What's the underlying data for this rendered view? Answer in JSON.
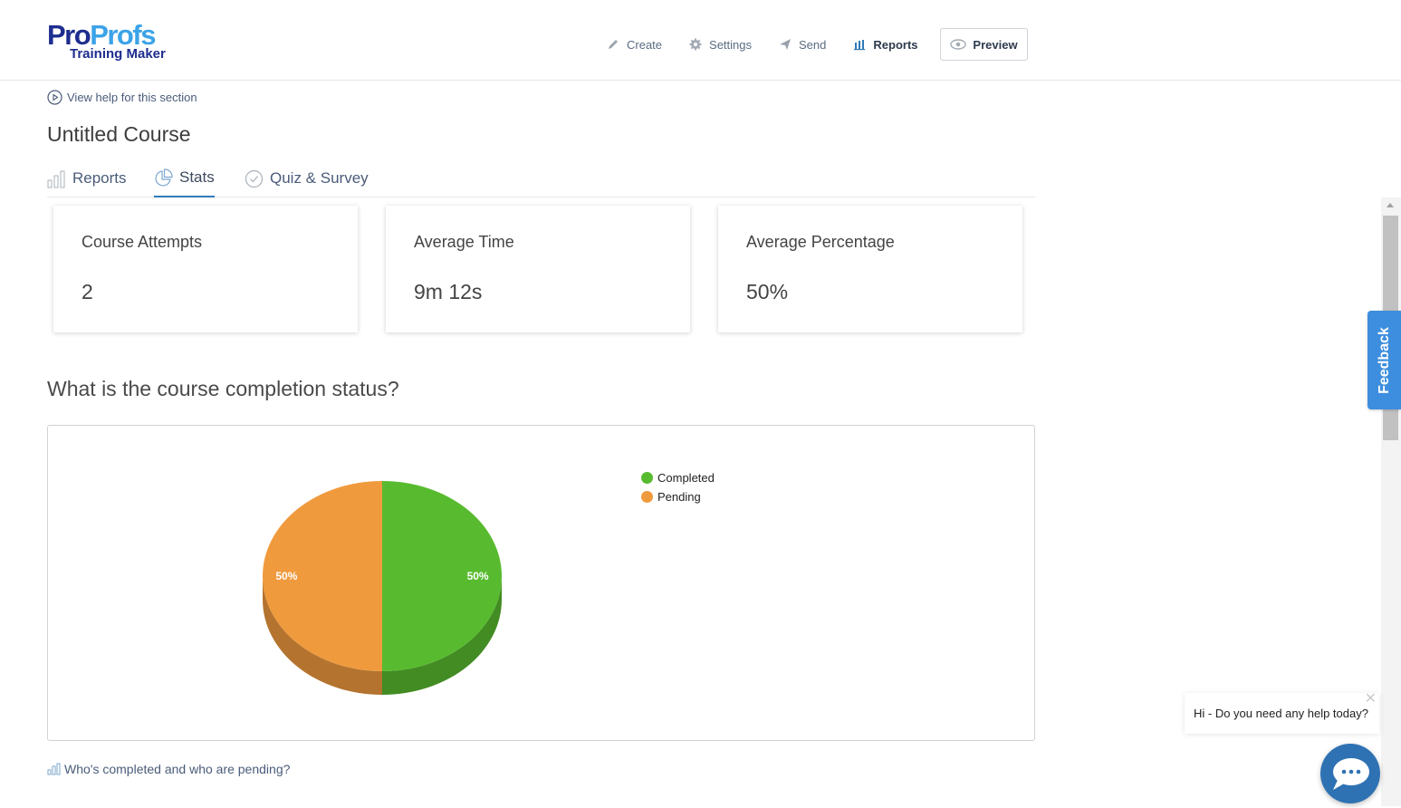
{
  "header": {
    "logo": {
      "brand_part1": "Pro",
      "brand_part2": "Profs",
      "product": "Training Maker"
    },
    "nav": [
      {
        "label": "Create",
        "icon": "pencil-icon"
      },
      {
        "label": "Settings",
        "icon": "gear-icon"
      },
      {
        "label": "Send",
        "icon": "paper-plane-icon"
      },
      {
        "label": "Reports",
        "icon": "bar-chart-icon",
        "active": true
      }
    ],
    "preview_label": "Preview"
  },
  "help_link": "View help for this section",
  "page_title": "Untitled Course",
  "tabs": [
    {
      "label": "Reports",
      "icon": "bar-chart-icon"
    },
    {
      "label": "Stats",
      "icon": "pie-chart-icon",
      "active": true
    },
    {
      "label": "Quiz & Survey",
      "icon": "check-circle-icon"
    }
  ],
  "stats_cards": [
    {
      "label": "Course Attempts",
      "value": "2"
    },
    {
      "label": "Average Time",
      "value": "9m 12s"
    },
    {
      "label": "Average Percentage",
      "value": "50%"
    }
  ],
  "completion_section": {
    "question": "What is the course completion status?",
    "link": "Who's completed and who are pending?"
  },
  "chart_data": {
    "type": "pie",
    "style": "3d",
    "title": "",
    "categories": [
      "Completed",
      "Pending"
    ],
    "values": [
      50,
      50
    ],
    "data_labels": [
      "50%",
      "50%"
    ],
    "colors": [
      "#58bb2f",
      "#f09a3e"
    ],
    "legend": "right"
  },
  "feedback_label": "Feedback",
  "chat": {
    "message": "Hi - Do you need any help today?",
    "close_icon": "close-icon"
  },
  "colors": {
    "brand_dark": "#1d2d8f",
    "brand_light": "#3ba3e8",
    "accent": "#2f7ab8",
    "feedback": "#3d8ede"
  }
}
